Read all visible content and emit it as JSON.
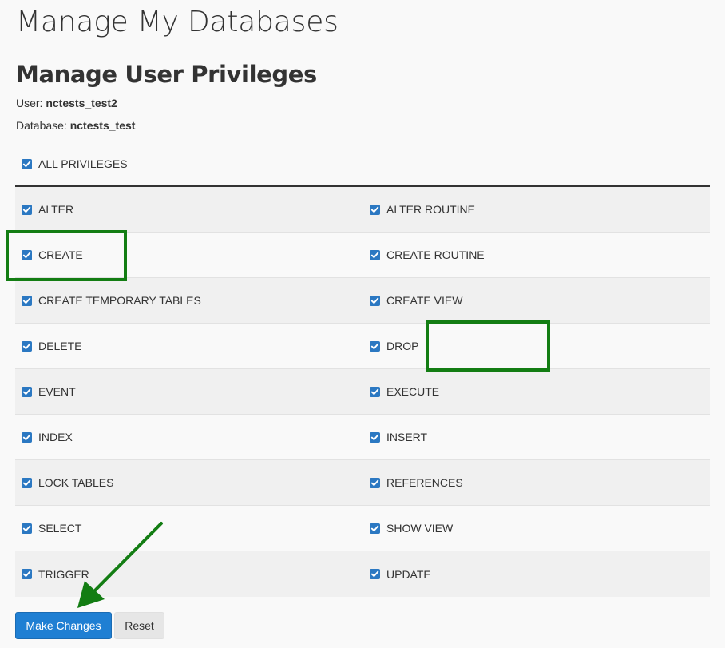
{
  "page": {
    "title": "Manage My Databases",
    "section_title": "Manage User Privileges"
  },
  "meta": {
    "user_label": "User:",
    "user_value": "nctests_test2",
    "database_label": "Database:",
    "database_value": "nctests_test"
  },
  "all_privileges": {
    "label": "ALL PRIVILEGES",
    "checked": true
  },
  "privileges": [
    {
      "left": "ALTER",
      "right": "ALTER ROUTINE"
    },
    {
      "left": "CREATE",
      "right": "CREATE ROUTINE"
    },
    {
      "left": "CREATE TEMPORARY TABLES",
      "right": "CREATE VIEW"
    },
    {
      "left": "DELETE",
      "right": "DROP"
    },
    {
      "left": "EVENT",
      "right": "EXECUTE"
    },
    {
      "left": "INDEX",
      "right": "INSERT"
    },
    {
      "left": "LOCK TABLES",
      "right": "REFERENCES"
    },
    {
      "left": "SELECT",
      "right": "SHOW VIEW"
    },
    {
      "left": "TRIGGER",
      "right": "UPDATE"
    }
  ],
  "buttons": {
    "make_changes": "Make Changes",
    "reset": "Reset"
  },
  "colors": {
    "checkbox": "#2b78c2",
    "highlight": "#137d13",
    "primary_button": "#1f7fd3"
  }
}
